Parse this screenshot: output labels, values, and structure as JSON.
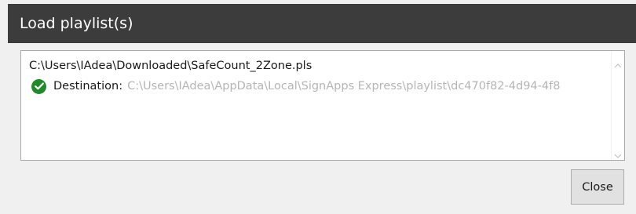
{
  "window": {
    "title": "Load playlist(s)"
  },
  "list": {
    "items": [
      {
        "path": "C:\\Users\\IAdea\\Downloaded\\SafeCount_2Zone.pls",
        "status_icon": "check-circle-icon",
        "status_color": "#1e8a28",
        "destination_label": "Destination:",
        "destination_value": "C:\\Users\\IAdea\\AppData\\Local\\SignApps Express\\playlist\\dc470f82-4d94-4f8"
      }
    ]
  },
  "buttons": {
    "close_label": "Close"
  },
  "colors": {
    "titlebar_bg": "#3c3c3c",
    "dialog_bg": "#f0f0f0",
    "destination_value_text": "#b5b5b5"
  }
}
